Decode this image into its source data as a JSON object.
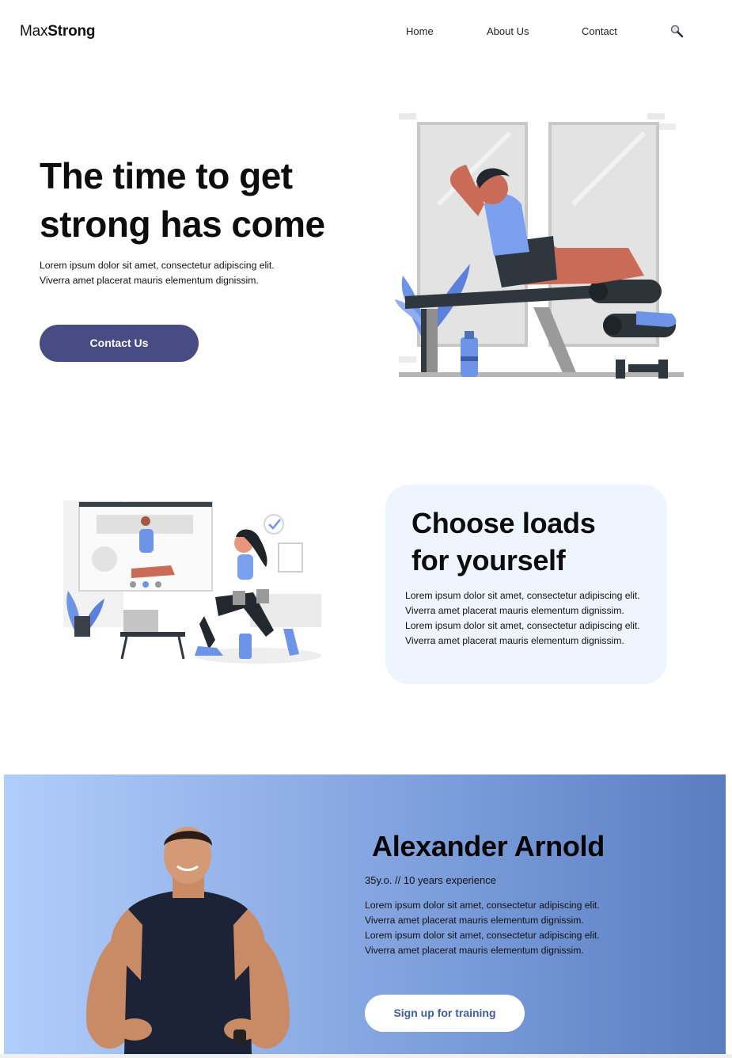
{
  "header": {
    "logo_light": "Max",
    "logo_bold": "Strong",
    "nav": [
      "Home",
      "About Us",
      "Contact"
    ],
    "search_icon": "search-icon"
  },
  "hero": {
    "title_line1": "The time to get",
    "title_bold": "strong",
    "title_rest": " has come",
    "description": "Lorem ipsum dolor sit amet, consectetur adipiscing elit. Viverra amet placerat mauris elementum dignissim.",
    "button_label": "Contact Us",
    "button_color": "#474c85"
  },
  "loads_card": {
    "title_line1": "Choose loads",
    "title_line2": "for yourself",
    "description": "Lorem ipsum dolor sit amet, consectetur adipiscing elit. Viverra amet placerat mauris elementum dignissim. Lorem ipsum dolor sit amet, consectetur adipiscing elit. Viverra amet placerat mauris elementum dignissim.",
    "background": "#eef5fe"
  },
  "trainer": {
    "name": "Alexander Arnold",
    "meta": "35y.o. // 10 years experience",
    "description": "Lorem ipsum dolor sit amet, consectetur adipiscing elit. Viverra amet placerat mauris elementum dignissim. Lorem ipsum dolor sit amet, consectetur adipiscing elit. Viverra amet placerat mauris elementum dignissim.",
    "button_label": "Sign up for training",
    "gradient_start": "#b1cdfb",
    "gradient_end": "#5a7dbf"
  }
}
